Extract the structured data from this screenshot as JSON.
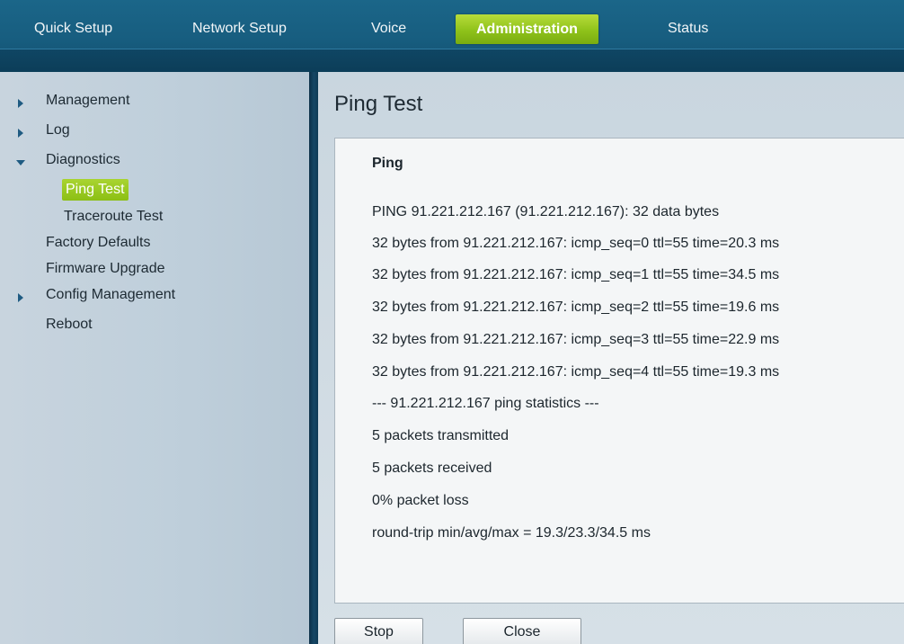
{
  "topnav": {
    "tabs": [
      {
        "label": "Quick Setup"
      },
      {
        "label": "Network Setup"
      },
      {
        "label": "Voice"
      },
      {
        "label": "Administration"
      },
      {
        "label": "Status"
      }
    ],
    "active_tab": "Administration",
    "colors": {
      "bar": "#175d7f",
      "active": "#9ccd24"
    }
  },
  "sidebar": {
    "items": [
      {
        "label": "Management",
        "icon": "arrow-right-icon"
      },
      {
        "label": "Log",
        "icon": "arrow-right-icon"
      },
      {
        "label": "Diagnostics",
        "icon": "arrow-down-icon"
      },
      {
        "label": "Ping Test"
      },
      {
        "label": "Traceroute Test"
      },
      {
        "label": "Factory Defaults"
      },
      {
        "label": "Firmware Upgrade"
      },
      {
        "label": "Config Management",
        "icon": "arrow-right-icon"
      },
      {
        "label": "Reboot"
      }
    ],
    "selected": "Ping Test"
  },
  "main": {
    "title": "Ping Test",
    "section_title": "Ping",
    "lines": [
      "PING 91.221.212.167 (91.221.212.167): 32 data bytes",
      "32 bytes from 91.221.212.167: icmp_seq=0 ttl=55 time=20.3 ms",
      "32 bytes from 91.221.212.167: icmp_seq=1 ttl=55 time=34.5 ms",
      "32 bytes from 91.221.212.167: icmp_seq=2 ttl=55 time=19.6 ms",
      "32 bytes from 91.221.212.167: icmp_seq=3 ttl=55 time=22.9 ms",
      "32 bytes from 91.221.212.167: icmp_seq=4 ttl=55 time=19.3 ms",
      "--- 91.221.212.167 ping statistics ---",
      "5 packets transmitted",
      "5 packets received",
      "0% packet loss",
      "round-trip min/avg/max = 19.3/23.3/34.5 ms"
    ],
    "buttons": {
      "stop": "Stop",
      "close": "Close"
    }
  }
}
